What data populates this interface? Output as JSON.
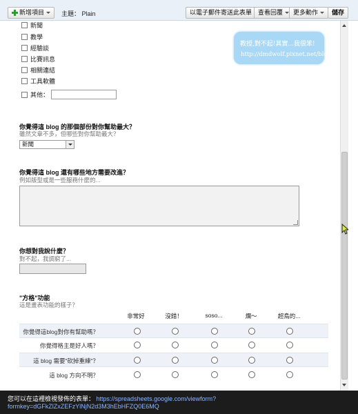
{
  "toolbar": {
    "new_item_label": "新增項目",
    "theme_label": "主題： Plain",
    "email_form_label": "以電子郵件寄送此表單",
    "view_responses_label": "查看回覆",
    "more_actions_label": "更多動作",
    "save_label": "儲存"
  },
  "checkbox_options": [
    "新聞",
    "教學",
    "經驗談",
    "比賽訊息",
    "相關連結",
    "工具軟體"
  ],
  "other_label": "其他：",
  "questions": {
    "q1": {
      "title": "你覺得這 blog 的那個部份對你幫助最大？",
      "help": "雖然文章不多，但哪些對你幫助最大？",
      "selected": "新聞"
    },
    "q2": {
      "title": "你覺得這 blog 還有哪些地方需要改進？",
      "help": "例如版型或是一些服務什麼的..."
    },
    "q3": {
      "title": "你想對我說什麼？",
      "help": "對不起，我調窮了..."
    },
    "q4": {
      "title": "\"方格\"功能",
      "help": "這是畫表功能的樣子？"
    }
  },
  "grid": {
    "columns": [
      "非常好",
      "沒錯！",
      "soso...",
      "爛～",
      "超鳥的..."
    ],
    "rows": [
      "你覺得這blog對你有幫助嗎？",
      "你覺得格主是好人嗎？",
      "這 blog 需要\"砍掉重練\"？",
      "這 blog 方向不明？"
    ]
  },
  "note": {
    "line1": "教授,對不起!其實...我很笨!",
    "line2": "http://dmdwolf.pixnet.net/blog"
  },
  "bottom": {
    "prefix": "您可以在這裡檢視發佈的表單：",
    "url_part1": "https://spreadsheets.google.com/viewform?",
    "url_part2": "formkey=dGFkZlZxZEFzYlNjN2d3M3hEbHFZQ0E6MQ"
  },
  "colors": {
    "toolbar_bg": "#eaf0f8",
    "note_bg": "#a8d8f5",
    "bottom_bg": "#1c1c1c",
    "link": "#8fb8ff"
  }
}
